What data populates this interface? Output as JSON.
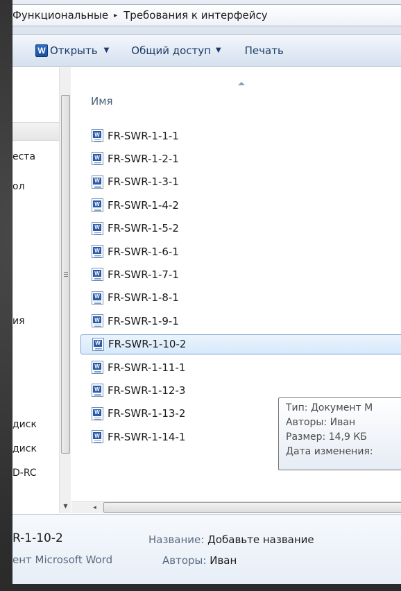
{
  "breadcrumb": {
    "items": [
      "Функциональные",
      "Требования к интерфейсу"
    ],
    "separator": "▸"
  },
  "toolbar": {
    "open_label": "Открыть",
    "share_label": "Общий доступ",
    "print_label": "Печать",
    "word_icon_letter": "W"
  },
  "nav": {
    "items": [
      "еста",
      "ол",
      "ия",
      "диск",
      "диск",
      "D-RC"
    ]
  },
  "filelist": {
    "column_name": "Имя",
    "selected_index": 9,
    "files": [
      "FR-SWR-1-1-1",
      "FR-SWR-1-2-1",
      "FR-SWR-1-3-1",
      "FR-SWR-1-4-2",
      "FR-SWR-1-5-2",
      "FR-SWR-1-6-1",
      "FR-SWR-1-7-1",
      "FR-SWR-1-8-1",
      "FR-SWR-1-9-1",
      "FR-SWR-1-10-2",
      "FR-SWR-1-11-1",
      "FR-SWR-1-12-3",
      "FR-SWR-1-13-2",
      "FR-SWR-1-14-1"
    ]
  },
  "tooltip": {
    "type": "Тип: Документ M",
    "authors": "Авторы: Иван",
    "size": "Размер: 14,9 КБ",
    "modified": "Дата изменения:"
  },
  "details": {
    "name": "R-1-10-2",
    "type": "ент Microsoft Word",
    "title_label": "Название:",
    "title_value": "Добавьте название",
    "authors_label": "Авторы:",
    "authors_value": "Иван"
  },
  "colors": {
    "selection_border": "#7da2ce",
    "toolbar_text": "#1e3c66",
    "word_blue": "#2a5aa8"
  }
}
